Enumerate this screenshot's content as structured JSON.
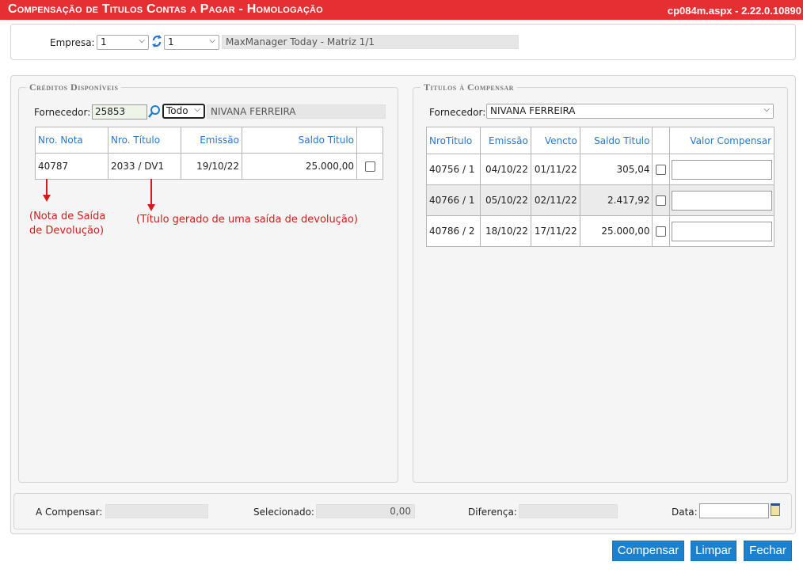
{
  "window": {
    "title": "Compensação de Titulos Contas a Pagar  - Homologação",
    "version": "cp084m.aspx - 2.22.0.10890"
  },
  "empresa": {
    "label": "Empresa:",
    "select1": "1",
    "select2": "1",
    "name": "MaxManager Today - Matriz 1/1"
  },
  "creditos": {
    "legend": "Créditos Disponíveis",
    "fornecedor_label": "Fornecedor:",
    "fornecedor_code": "25853",
    "filter": "Todo",
    "fornecedor_name": "NIVANA FERREIRA",
    "columns": [
      "Nro. Nota",
      "Nro. Título",
      "Emissão",
      "Saldo Titulo"
    ],
    "rows": [
      {
        "nota": "40787",
        "titulo": "2033 / DV1",
        "emissao": "19/10/22",
        "saldo": "25.000,00"
      }
    ]
  },
  "annotations": {
    "note1": "(Nota de Saída de Devolução)",
    "note2": "(Título gerado de uma saída de devolução)"
  },
  "titulos": {
    "legend": "Titulos à Compensar",
    "fornecedor_label": "Fornecedor:",
    "fornecedor_select": "NIVANA FERREIRA",
    "columns": [
      "NroTitulo",
      "Emissão",
      "Vencto",
      "Saldo Titulo",
      "Valor Compensar"
    ],
    "rows": [
      {
        "nro": "40756 / 1",
        "emissao": "04/10/22",
        "vencto": "01/11/22",
        "saldo": "305,04"
      },
      {
        "nro": "40766 / 1",
        "emissao": "05/10/22",
        "vencto": "02/11/22",
        "saldo": "2.417,92"
      },
      {
        "nro": "40786 / 2",
        "emissao": "18/10/22",
        "vencto": "17/11/22",
        "saldo": "25.000,00"
      }
    ]
  },
  "footer": {
    "a_compensar": "A Compensar:",
    "selecionado": "Selecionado:",
    "selecionado_value": "0,00",
    "diferenca": "Diferença:",
    "data": "Data:"
  },
  "buttons": {
    "compensar": "Compensar",
    "limpar": "Limpar",
    "fechar": "Fechar"
  },
  "colors": {
    "titlebar": "#e52f32",
    "accent": "#1b81cf",
    "header_text": "#2a77c9",
    "annotation": "#d21d1d"
  }
}
